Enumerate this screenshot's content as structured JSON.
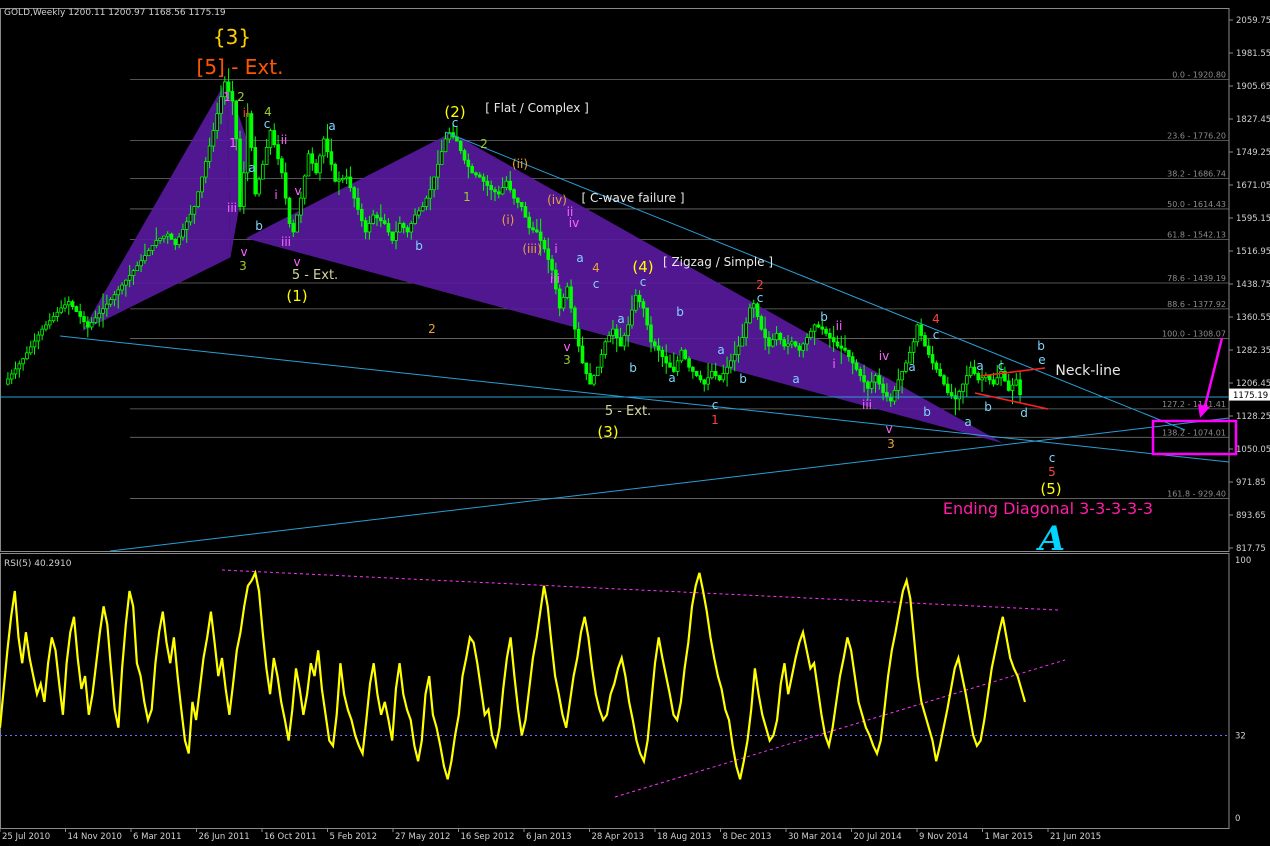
{
  "chart_data": [
    {
      "type": "candlestick",
      "header": {
        "symbol": "GOLD,Weekly",
        "open": "1200.11",
        "high": "1200.97",
        "low": "1168.56",
        "close": "1175.19"
      },
      "price_axis": {
        "min": 805,
        "max": 2090,
        "ticks": [
          "2059.75",
          "1981.55",
          "1905.65",
          "1827.45",
          "1749.25",
          "1671.05",
          "1595.15",
          "1516.95",
          "1438.75",
          "1360.55",
          "1282.35",
          "1206.45",
          "1128.25",
          "1050.05",
          "971.85",
          "893.65",
          "817.75"
        ],
        "current_price": "1175.19"
      },
      "time_axis": {
        "ticks": [
          "25 Jul 2010",
          "14 Nov 2010",
          "6 Mar 2011",
          "26 Jun 2011",
          "16 Oct 2011",
          "5 Feb 2012",
          "27 May 2012",
          "16 Sep 2012",
          "6 Jan 2013",
          "28 Apr 2013",
          "18 Aug 2013",
          "8 Dec 2013",
          "30 Mar 2014",
          "20 Jul 2014",
          "9 Nov 2014",
          "1 Mar 2015",
          "21 Jun 2015"
        ]
      },
      "price_path": [
        [
          0,
          1200
        ],
        [
          5,
          1260
        ],
        [
          10,
          1330
        ],
        [
          15,
          1380
        ],
        [
          17,
          1395
        ],
        [
          20,
          1360
        ],
        [
          22,
          1335
        ],
        [
          28,
          1400
        ],
        [
          35,
          1480
        ],
        [
          40,
          1540
        ],
        [
          43,
          1555
        ],
        [
          45,
          1530
        ],
        [
          50,
          1620
        ],
        [
          52,
          1690
        ],
        [
          55,
          1800
        ],
        [
          57,
          1880
        ],
        [
          58,
          1915
        ],
        [
          60,
          1870
        ],
        [
          61,
          1780
        ],
        [
          62,
          1620
        ],
        [
          63,
          1700
        ],
        [
          64,
          1840
        ],
        [
          65,
          1760
        ],
        [
          66,
          1650
        ],
        [
          68,
          1720
        ],
        [
          70,
          1800
        ],
        [
          73,
          1700
        ],
        [
          75,
          1580
        ],
        [
          76,
          1560
        ],
        [
          78,
          1640
        ],
        [
          80,
          1745
        ],
        [
          82,
          1700
        ],
        [
          84,
          1780
        ],
        [
          86,
          1720
        ],
        [
          87,
          1680
        ],
        [
          90,
          1690
        ],
        [
          92,
          1640
        ],
        [
          95,
          1560
        ],
        [
          97,
          1600
        ],
        [
          100,
          1580
        ],
        [
          102,
          1540
        ],
        [
          104,
          1580
        ],
        [
          106,
          1560
        ],
        [
          108,
          1600
        ],
        [
          110,
          1620
        ],
        [
          112,
          1660
        ],
        [
          114,
          1720
        ],
        [
          116,
          1780
        ],
        [
          117,
          1795
        ],
        [
          119,
          1775
        ],
        [
          121,
          1730
        ],
        [
          123,
          1700
        ],
        [
          125,
          1690
        ],
        [
          128,
          1660
        ],
        [
          130,
          1650
        ],
        [
          132,
          1680
        ],
        [
          134,
          1640
        ],
        [
          136,
          1620
        ],
        [
          138,
          1570
        ],
        [
          140,
          1560
        ],
        [
          142,
          1520
        ],
        [
          144,
          1470
        ],
        [
          146,
          1380
        ],
        [
          148,
          1430
        ],
        [
          150,
          1330
        ],
        [
          152,
          1250
        ],
        [
          154,
          1200
        ],
        [
          156,
          1240
        ],
        [
          158,
          1300
        ],
        [
          160,
          1330
        ],
        [
          162,
          1290
        ],
        [
          164,
          1340
        ],
        [
          166,
          1410
        ],
        [
          168,
          1380
        ],
        [
          170,
          1300
        ],
        [
          172,
          1280
        ],
        [
          174,
          1250
        ],
        [
          176,
          1230
        ],
        [
          178,
          1280
        ],
        [
          180,
          1240
        ],
        [
          182,
          1220
        ],
        [
          184,
          1200
        ],
        [
          186,
          1230
        ],
        [
          188,
          1210
        ],
        [
          190,
          1240
        ],
        [
          192,
          1270
        ],
        [
          194,
          1310
        ],
        [
          196,
          1380
        ],
        [
          197,
          1390
        ],
        [
          199,
          1330
        ],
        [
          201,
          1290
        ],
        [
          203,
          1320
        ],
        [
          205,
          1290
        ],
        [
          207,
          1300
        ],
        [
          209,
          1280
        ],
        [
          211,
          1310
        ],
        [
          213,
          1340
        ],
        [
          215,
          1330
        ],
        [
          217,
          1310
        ],
        [
          219,
          1290
        ],
        [
          221,
          1280
        ],
        [
          223,
          1250
        ],
        [
          225,
          1220
        ],
        [
          227,
          1190
        ],
        [
          229,
          1220
        ],
        [
          231,
          1180
        ],
        [
          233,
          1160
        ],
        [
          235,
          1210
        ],
        [
          237,
          1250
        ],
        [
          239,
          1300
        ],
        [
          240,
          1340
        ],
        [
          242,
          1290
        ],
        [
          244,
          1250
        ],
        [
          246,
          1220
        ],
        [
          248,
          1180
        ],
        [
          250,
          1165
        ],
        [
          252,
          1200
        ],
        [
          254,
          1240
        ],
        [
          256,
          1210
        ],
        [
          258,
          1220
        ],
        [
          260,
          1200
        ],
        [
          262,
          1230
        ],
        [
          264,
          1185
        ],
        [
          266,
          1210
        ],
        [
          267,
          1175
        ]
      ],
      "fib_levels": [
        {
          "label": "0.0 - 1920.80",
          "value": 1920.8
        },
        {
          "label": "23.6 - 1776.20",
          "value": 1776.2
        },
        {
          "label": "38.2 - 1686.74",
          "value": 1686.74
        },
        {
          "label": "50.0 - 1614.43",
          "value": 1614.43
        },
        {
          "label": "61.8 - 1542.13",
          "value": 1542.13
        },
        {
          "label": "78.6 - 1439.19",
          "value": 1439.19
        },
        {
          "label": "88.6 - 1377.92",
          "value": 1377.92
        },
        {
          "label": "100.0 - 1308.07",
          "value": 1308.07
        },
        {
          "label": "127.2 - 1141.41",
          "value": 1141.41
        },
        {
          "label": "138.2 - 1074.01",
          "value": 1074.01
        },
        {
          "label": "161.8 - 929.40",
          "value": 929.4
        }
      ],
      "annotations": {
        "wave3_curly": "{3}",
        "wave5_ext": "[5] - Ext.",
        "flat_complex": "[ Flat / Complex ]",
        "cwave_failure": "[ C-wave failure ]",
        "zigzag_simple": "[ Zigzag / Simple ]",
        "neck_line": "Neck-line",
        "ending_diagonal": "Ending Diagonal 3-3-3-3-3",
        "w1": "(1)",
        "w2": "(2)",
        "w3": "(3)",
        "w4": "(4)",
        "w5": "(5)",
        "ext5_1": "5 - Ext.",
        "ext5_2": "5 - Ext.",
        "logo": "A"
      },
      "colors": {
        "bull_candle": "#00ff00",
        "wedge_fill": "#5a1aa0",
        "trendline": "#2a9fd6",
        "fib": "#8c8c8c",
        "wave_yellow": "#ffff00",
        "wave_orange": "#ff5500",
        "neckline": "#ff2020",
        "highlight": "#ff00ff"
      }
    },
    {
      "type": "line",
      "title": "RSI(5) 40.2910",
      "ylim": [
        0,
        100
      ],
      "axis_ticks": [
        "100",
        "32",
        "0"
      ],
      "levels": [
        32
      ],
      "series": [
        {
          "values": [
            35,
            50,
            65,
            78,
            88,
            70,
            60,
            72,
            62,
            55,
            48,
            52,
            45,
            60,
            70,
            65,
            52,
            40,
            60,
            72,
            78,
            62,
            50,
            55,
            40,
            48,
            60,
            72,
            82,
            75,
            58,
            42,
            35,
            58,
            75,
            88,
            82,
            60,
            55,
            45,
            38,
            42,
            60,
            72,
            80,
            68,
            60,
            70,
            55,
            42,
            30,
            25,
            45,
            38,
            50,
            62,
            70,
            80,
            68,
            55,
            62,
            50,
            40,
            52,
            65,
            72,
            82,
            90,
            92,
            95,
            88,
            72,
            58,
            48,
            62,
            55,
            45,
            38,
            30,
            42,
            58,
            50,
            40,
            48,
            60,
            55,
            65,
            50,
            40,
            30,
            28,
            40,
            60,
            48,
            42,
            38,
            32,
            28,
            25,
            38,
            52,
            60,
            48,
            40,
            45,
            38,
            30,
            50,
            60,
            48,
            42,
            38,
            28,
            22,
            30,
            48,
            55,
            40,
            35,
            28,
            20,
            15,
            22,
            32,
            40,
            55,
            62,
            70,
            68,
            60,
            50,
            40,
            42,
            32,
            28,
            35,
            50,
            62,
            70,
            55,
            42,
            32,
            38,
            50,
            62,
            70,
            80,
            90,
            82,
            68,
            55,
            48,
            40,
            35,
            45,
            55,
            62,
            72,
            78,
            70,
            58,
            48,
            42,
            38,
            40,
            48,
            52,
            58,
            62,
            55,
            45,
            38,
            30,
            25,
            22,
            30,
            45,
            60,
            70,
            62,
            55,
            48,
            40,
            38,
            45,
            58,
            68,
            82,
            90,
            95,
            88,
            80,
            70,
            62,
            55,
            50,
            42,
            38,
            28,
            20,
            15,
            22,
            30,
            42,
            58,
            48,
            40,
            35,
            30,
            32,
            38,
            52,
            60,
            48,
            55,
            62,
            68,
            72,
            65,
            58,
            60,
            50,
            40,
            32,
            28,
            35,
            45,
            55,
            62,
            70,
            65,
            55,
            45,
            40,
            35,
            32,
            28,
            25,
            30,
            42,
            55,
            65,
            72,
            80,
            88,
            92,
            85,
            70,
            55,
            45,
            40,
            35,
            30,
            22,
            28,
            35,
            42,
            50,
            58,
            62,
            55,
            48,
            40,
            32,
            28,
            30,
            38,
            48,
            58,
            65,
            72,
            78,
            70,
            62,
            58,
            55,
            50,
            45
          ]
        }
      ],
      "trendlines_note": "descending resistance and ascending support"
    }
  ]
}
